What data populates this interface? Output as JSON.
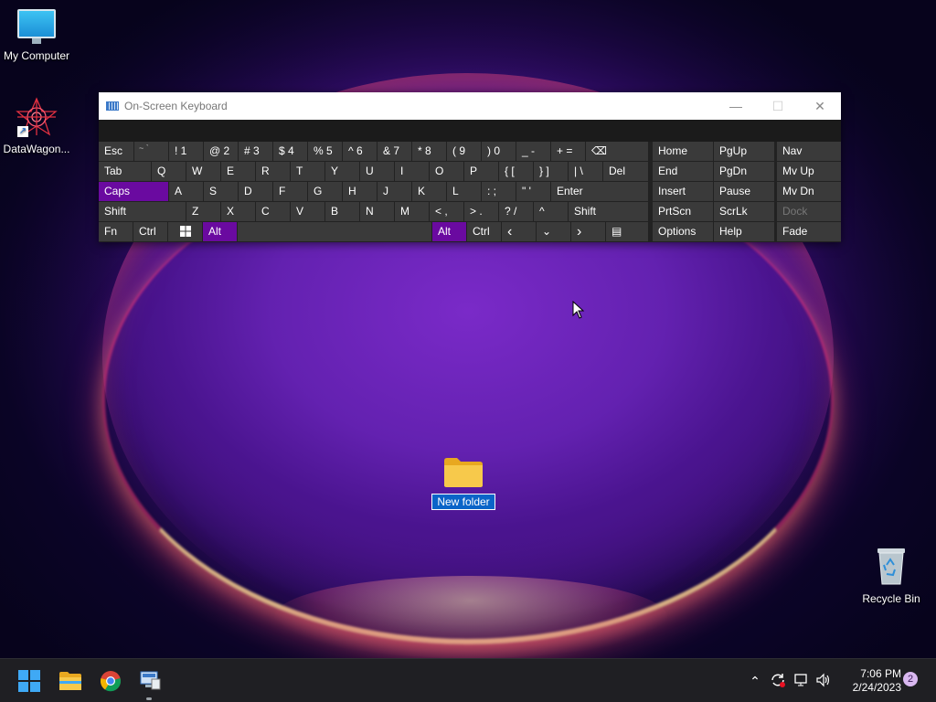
{
  "desktop": {
    "icons": {
      "my_computer": "My Computer",
      "datawagon": "DataWagon...",
      "recycle_bin": "Recycle Bin",
      "new_folder": "New folder"
    }
  },
  "osk": {
    "title": "On-Screen Keyboard",
    "row1": {
      "esc": "Esc",
      "k1": [
        "~ `",
        "! 1",
        "@ 2",
        "# 3",
        "$ 4",
        "% 5",
        "^ 6",
        "& 7",
        "* 8",
        "( 9",
        ") 0",
        "_ -",
        "+ ="
      ]
    },
    "keys": {
      "backspace": "⌫",
      "tab": "Tab",
      "q": "Q",
      "w": "W",
      "e": "E",
      "r": "R",
      "t": "T",
      "y": "Y",
      "u": "U",
      "i": "I",
      "o": "O",
      "p": "P",
      "brace_open": "{ [",
      "brace_close": "} ]",
      "pipe": "| \\",
      "del": "Del",
      "caps": "Caps",
      "a": "A",
      "s": "S",
      "d": "D",
      "f": "F",
      "g": "G",
      "h": "H",
      "j": "J",
      "k": "K",
      "l": "L",
      "colon": ": ;",
      "quote": "\" '",
      "enter": "Enter",
      "shift_left": "Shift",
      "z": "Z",
      "x": "X",
      "c": "C",
      "v": "V",
      "b": "B",
      "n": "N",
      "m": "M",
      "lt": "< ,",
      "gt": "> .",
      "question": "? /",
      "up": "^",
      "shift_right": "Shift",
      "fn": "Fn",
      "ctrl_left": "Ctrl",
      "alt_left": "Alt",
      "alt_right": "Alt",
      "ctrl_right": "Ctrl",
      "left": "‹",
      "down": "⌄",
      "right": "›",
      "menu": "▤",
      "home": "Home",
      "pgup": "PgUp",
      "nav": "Nav",
      "end": "End",
      "pgdn": "PgDn",
      "mvup": "Mv Up",
      "insert": "Insert",
      "pause": "Pause",
      "mvdn": "Mv Dn",
      "prtscn": "PrtScn",
      "scrlk": "ScrLk",
      "dock": "Dock",
      "options": "Options",
      "help": "Help",
      "fade": "Fade"
    }
  },
  "taskbar": {
    "time": "7:06 PM",
    "date": "2/24/2023",
    "notification_count": "2"
  }
}
